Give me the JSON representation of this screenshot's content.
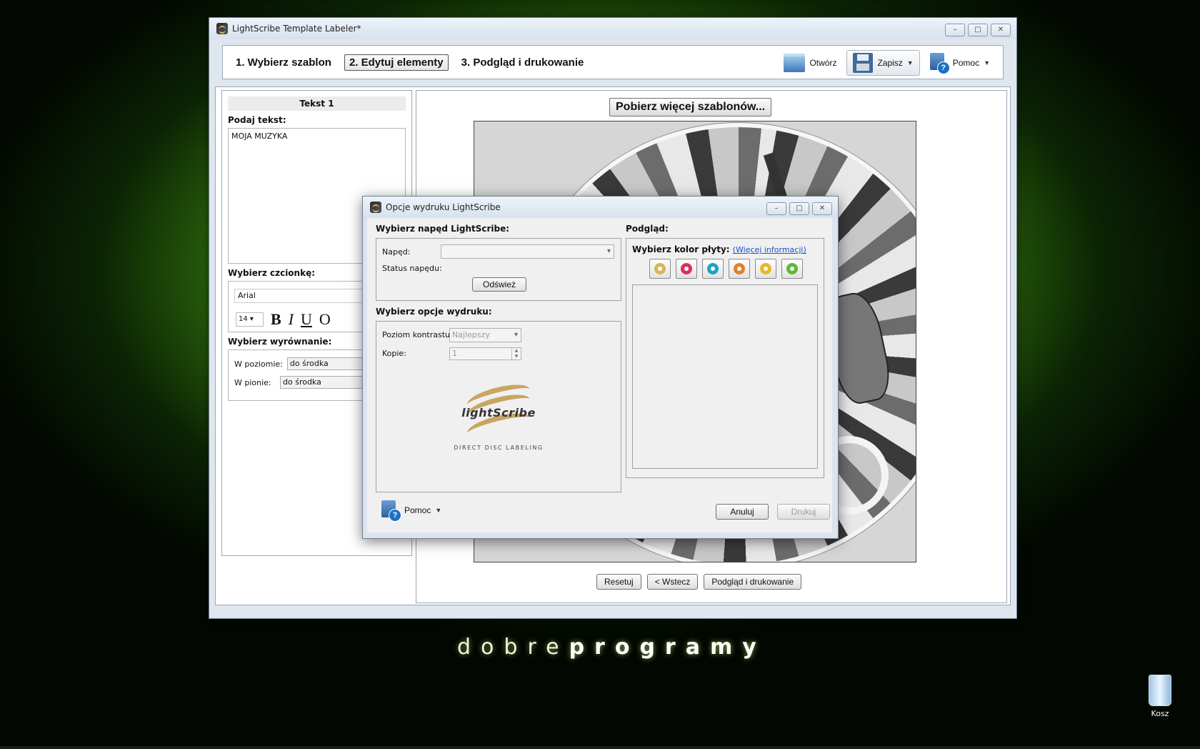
{
  "window": {
    "title": "LightScribe Template Labeler*",
    "min": "–",
    "max": "□",
    "close": "✕"
  },
  "steps": [
    "1. Wybierz szablon",
    "2. Edytuj elementy",
    "3. Podgląd i drukowanie"
  ],
  "toolbar": {
    "open": "Otwórz",
    "save": "Zapisz",
    "help": "Pomoc"
  },
  "left": {
    "header": "Tekst 1",
    "text_label": "Podaj tekst:",
    "text_value": "MOJA MUZYKA",
    "font_label": "Wybierz czcionkę:",
    "font_value": "Arial",
    "size_value": "14",
    "bold": "B",
    "italic": "I",
    "underline": "U",
    "outline": "O",
    "align_label": "Wybierz wyrównanie:",
    "h_label": "W poziomie:",
    "h_value": "do środka",
    "v_label": "W pionie:",
    "v_value": "do środka"
  },
  "right": {
    "more_templates": "Pobierz więcej szablonów...",
    "reset": "Resetuj",
    "back": "< Wstecz",
    "preview_print": "Podgląd i drukowanie"
  },
  "dialog": {
    "title": "Opcje wydruku LightScribe",
    "drive_section": "Wybierz napęd LightScribe:",
    "drive_label": "Napęd:",
    "drive_value": "",
    "status_label": "Status napędu:",
    "refresh": "Odśwież",
    "options_section": "Wybierz opcje wydruku:",
    "contrast_label": "Poziom kontrastu:",
    "contrast_value": "Najlepszy",
    "copies_label": "Kopie:",
    "copies_value": "1",
    "logo_word": "lightScribe",
    "logo_sub": "DIRECT DISC LABELING",
    "preview_section": "Podgląd:",
    "disc_color_label": "Wybierz kolor płyty:",
    "more_info": "(Więcej informacji)",
    "help": "Pomoc",
    "cancel": "Anuluj",
    "print": "Drukuj",
    "swatch_colors": [
      "#d6b65a",
      "#d9315a",
      "#1aa3c4",
      "#e0812a",
      "#e8b72a",
      "#5fb83a"
    ]
  },
  "desktop": {
    "brand_light": "dobre",
    "brand_bold": "programy",
    "trash_label": "Kosz"
  }
}
